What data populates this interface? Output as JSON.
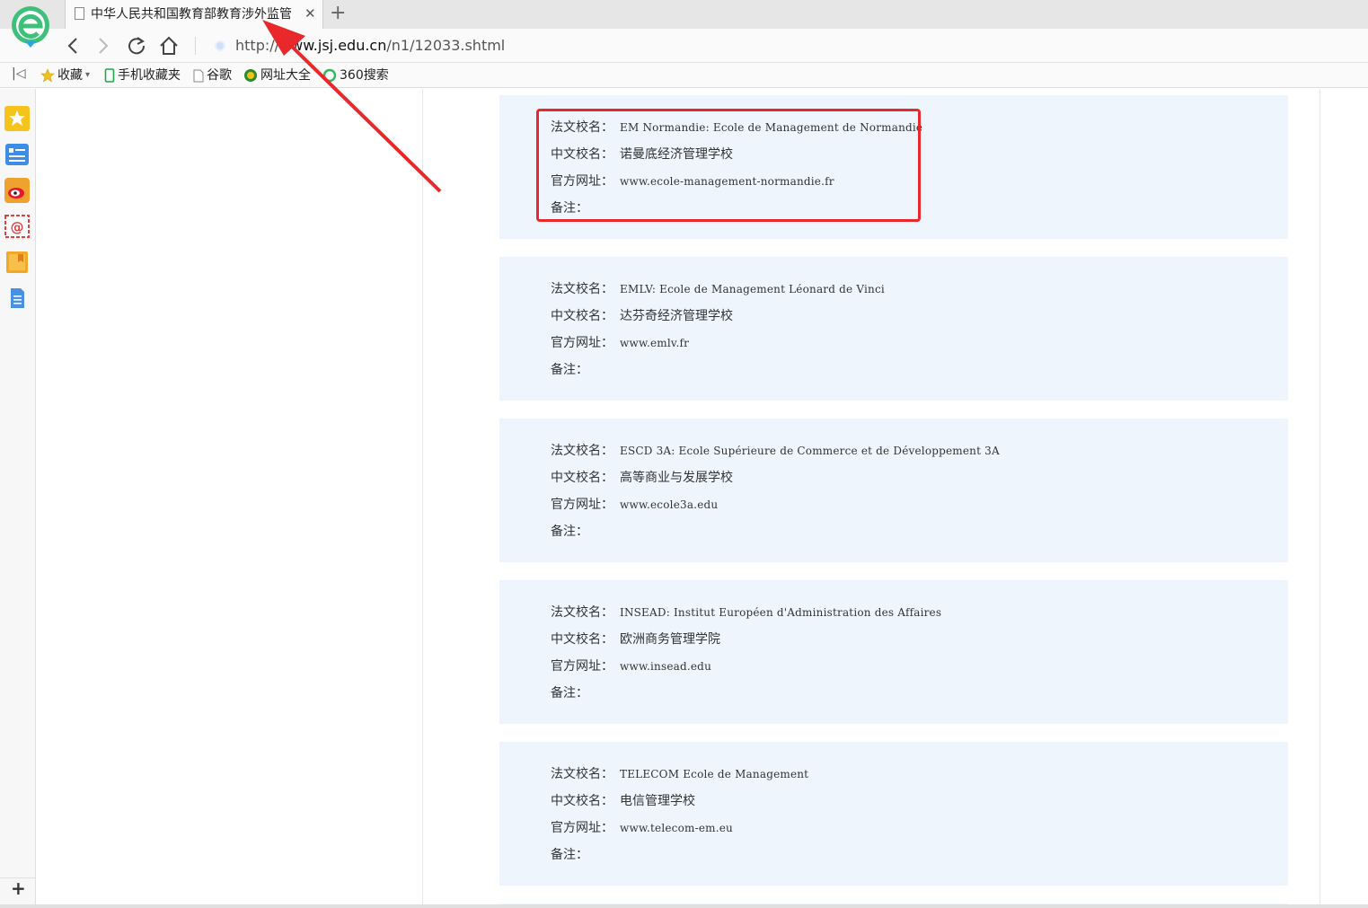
{
  "browser": {
    "tab_title": "中华人民共和国教育部教育涉外监管",
    "url_prefix": "http://",
    "url_domain": "www.jsj.edu.cn",
    "url_path": "/n1/12033.shtml"
  },
  "bookmarks": [
    {
      "label": "收藏",
      "icon": "star-icon"
    },
    {
      "label": "手机收藏夹",
      "icon": "phone-icon"
    },
    {
      "label": "谷歌",
      "icon": "page-icon"
    },
    {
      "label": "网址大全",
      "icon": "globe-icon"
    },
    {
      "label": "360搜索",
      "icon": "search-ring-icon"
    }
  ],
  "sidebar_icons": [
    "favorites-star-icon",
    "news-icon",
    "weibo-icon",
    "mail-icon",
    "bookmark-book-icon",
    "document-icon"
  ],
  "labels": {
    "fr_name": "法文校名：",
    "cn_name": "中文校名：",
    "website": "官方网址：",
    "note": "备注："
  },
  "schools": [
    {
      "fr_name": "EM Normandie: Ecole de Management de Normandie",
      "cn_name": "诺曼底经济管理学校",
      "website": "www.ecole-management-normandie.fr",
      "note": ""
    },
    {
      "fr_name": "EMLV: Ecole de Management Léonard de Vinci",
      "cn_name": "达芬奇经济管理学校",
      "website": "www.emlv.fr",
      "note": ""
    },
    {
      "fr_name": "ESCD 3A: Ecole Supérieure de Commerce et de Développement 3A",
      "cn_name": "高等商业与发展学校",
      "website": "www.ecole3a.edu",
      "note": ""
    },
    {
      "fr_name": "INSEAD: Institut Européen d'Administration des Affaires",
      "cn_name": "欧洲商务管理学院",
      "website": "www.insead.edu",
      "note": ""
    },
    {
      "fr_name": "TELECOM Ecole de Management",
      "cn_name": "电信管理学校",
      "website": "www.telecom-em.eu",
      "note": ""
    }
  ],
  "colors": {
    "card_bg": "#eef5fc",
    "highlight": "#e8282b",
    "arrow": "#e8282b"
  }
}
